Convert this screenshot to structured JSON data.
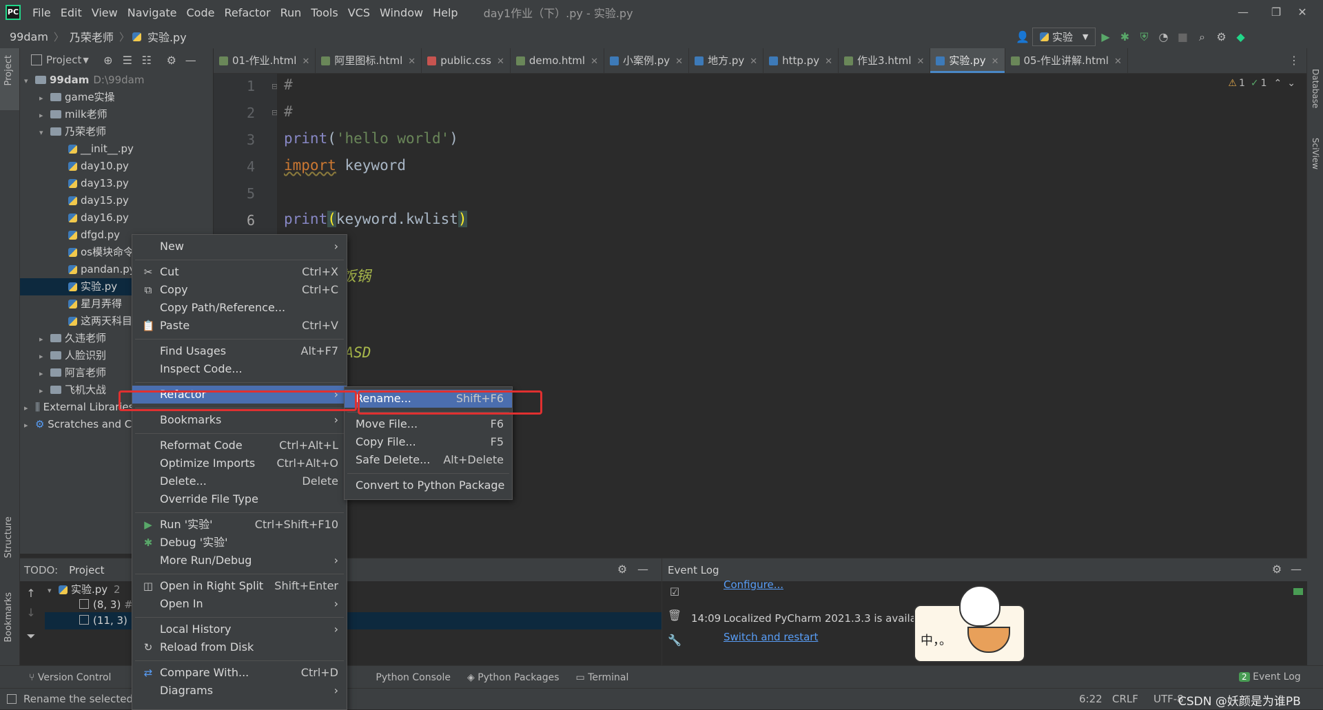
{
  "app": {
    "menu": [
      "File",
      "Edit",
      "View",
      "Navigate",
      "Code",
      "Refactor",
      "Run",
      "Tools",
      "VCS",
      "Window",
      "Help"
    ],
    "window_title": "day1作业（下）.py - 实验.py"
  },
  "navbar": {
    "crumbs": [
      "99dam",
      "乃荣老师",
      "实验.py"
    ],
    "run_config": "实验"
  },
  "left_strip": {
    "project": "Project",
    "structure": "Structure",
    "bookmarks": "Bookmarks"
  },
  "right_strip": {
    "database": "Database",
    "sciview": "SciView"
  },
  "project_panel": {
    "title": "Project",
    "tree": [
      {
        "label": "99dam",
        "extra": "D:\\99dam",
        "kind": "folder",
        "level": 0,
        "arrow": "▾"
      },
      {
        "label": "game实操",
        "kind": "folder",
        "level": 1,
        "arrow": "▸"
      },
      {
        "label": "milk老师",
        "kind": "folder",
        "level": 1,
        "arrow": "▸"
      },
      {
        "label": "乃荣老师",
        "kind": "folder",
        "level": 1,
        "arrow": "▾"
      },
      {
        "label": "__init__.py",
        "kind": "py",
        "level": 2
      },
      {
        "label": "day10.py",
        "kind": "py",
        "level": 2
      },
      {
        "label": "day13.py",
        "kind": "py",
        "level": 2
      },
      {
        "label": "day15.py",
        "kind": "py",
        "level": 2
      },
      {
        "label": "day16.py",
        "kind": "py",
        "level": 2
      },
      {
        "label": "dfgd.py",
        "kind": "py",
        "level": 2
      },
      {
        "label": "os模块命令",
        "kind": "py",
        "level": 2
      },
      {
        "label": "pandan.py",
        "kind": "py",
        "level": 2
      },
      {
        "label": "实验.py",
        "kind": "py",
        "level": 2,
        "selected": true
      },
      {
        "label": "星月弄得",
        "kind": "py",
        "level": 2
      },
      {
        "label": "这两天科目",
        "kind": "py",
        "level": 2
      },
      {
        "label": "久违老师",
        "kind": "folder",
        "level": 1,
        "arrow": "▸"
      },
      {
        "label": "人脸识别",
        "kind": "folder",
        "level": 1,
        "arrow": "▸"
      },
      {
        "label": "阿言老师",
        "kind": "folder",
        "level": 1,
        "arrow": "▸"
      },
      {
        "label": "飞机大战",
        "kind": "folder",
        "level": 1,
        "arrow": "▸"
      },
      {
        "label": "External Libraries",
        "kind": "lib",
        "level": 0,
        "arrow": "▸"
      },
      {
        "label": "Scratches and Consoles",
        "kind": "scratch",
        "level": 0,
        "arrow": "▸"
      }
    ]
  },
  "tabs": [
    {
      "label": "01-作业.html",
      "color": "#6a8759"
    },
    {
      "label": "阿里图标.html",
      "color": "#6a8759"
    },
    {
      "label": "public.css",
      "color": "#c75450"
    },
    {
      "label": "demo.html",
      "color": "#6a8759"
    },
    {
      "label": "小案例.py",
      "color": "#3d7ab8"
    },
    {
      "label": "地方.py",
      "color": "#3d7ab8"
    },
    {
      "label": "http.py",
      "color": "#3d7ab8"
    },
    {
      "label": "作业3.html",
      "color": "#6a8759"
    },
    {
      "label": "实验.py",
      "color": "#3d7ab8",
      "active": true
    },
    {
      "label": "05-作业讲解.html",
      "color": "#6a8759"
    }
  ],
  "editor": {
    "line_numbers": [
      "1",
      "2",
      "3",
      "4",
      "5",
      "6"
    ],
    "inspections": {
      "warnings": "1",
      "weak": "1"
    },
    "comment1": "第三方电饭锅",
    "comment2": "SaaSASDASD"
  },
  "context_menu": {
    "items": [
      {
        "label": "New",
        "sub": true
      },
      {
        "sep": true
      },
      {
        "label": "Cut",
        "sc": "Ctrl+X",
        "icon": "✂"
      },
      {
        "label": "Copy",
        "sc": "Ctrl+C",
        "icon": "⧉"
      },
      {
        "label": "Copy Path/Reference..."
      },
      {
        "label": "Paste",
        "sc": "Ctrl+V",
        "icon": "📋"
      },
      {
        "sep": true
      },
      {
        "label": "Find Usages",
        "sc": "Alt+F7"
      },
      {
        "label": "Inspect Code..."
      },
      {
        "sep": true
      },
      {
        "label": "Refactor",
        "sub": true,
        "hl": true
      },
      {
        "sep": true
      },
      {
        "label": "Bookmarks",
        "sub": true
      },
      {
        "sep": true
      },
      {
        "label": "Reformat Code",
        "sc": "Ctrl+Alt+L"
      },
      {
        "label": "Optimize Imports",
        "sc": "Ctrl+Alt+O"
      },
      {
        "label": "Delete...",
        "sc": "Delete"
      },
      {
        "label": "Override File Type"
      },
      {
        "sep": true
      },
      {
        "label": "Run '实验'",
        "sc": "Ctrl+Shift+F10",
        "icon": "▶",
        "iconColor": "#59a869"
      },
      {
        "label": "Debug '实验'",
        "icon": "✱",
        "iconColor": "#59a869"
      },
      {
        "label": "More Run/Debug",
        "sub": true
      },
      {
        "sep": true
      },
      {
        "label": "Open in Right Split",
        "sc": "Shift+Enter",
        "icon": "◫"
      },
      {
        "label": "Open In",
        "sub": true
      },
      {
        "sep": true
      },
      {
        "label": "Local History",
        "sub": true
      },
      {
        "label": "Reload from Disk",
        "icon": "↻"
      },
      {
        "sep": true
      },
      {
        "label": "Compare With...",
        "sc": "Ctrl+D",
        "icon": "⇄",
        "iconColor": "#589df6"
      },
      {
        "label": "Diagrams",
        "sub": true
      }
    ]
  },
  "submenu": {
    "items": [
      {
        "label": "Rename...",
        "sc": "Shift+F6",
        "hl": true
      },
      {
        "sep": true
      },
      {
        "label": "Move File...",
        "sc": "F6"
      },
      {
        "label": "Copy File...",
        "sc": "F5"
      },
      {
        "label": "Safe Delete...",
        "sc": "Alt+Delete"
      },
      {
        "sep": true
      },
      {
        "label": "Convert to Python Package"
      }
    ]
  },
  "todo_panel": {
    "tabs": [
      "TODO:",
      "Project"
    ],
    "file": "实验.py",
    "file_count": "2",
    "items": [
      "(8, 3)",
      "(11, 3)"
    ]
  },
  "event_log": {
    "title": "Event Log",
    "link_top": "Configure...",
    "time": "14:09",
    "message": "Localized PyCharm 2021.3.3 is available",
    "link": "Switch and restart"
  },
  "tool_windows": [
    "Version Control",
    "Python Console",
    "Python Packages",
    "Terminal"
  ],
  "event_log_button": {
    "count": "2",
    "label": "Event Log"
  },
  "status": {
    "message": "Rename the selected",
    "position": "6:22",
    "line_sep": "CRLF",
    "encoding": "UTF-8",
    "watermark": "CSDN @妖颜是为谁PB"
  },
  "sticker": {
    "text": "中，。"
  }
}
